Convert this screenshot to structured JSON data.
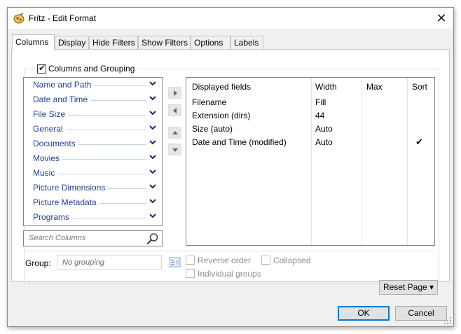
{
  "window": {
    "title": "Fritz - Edit Format",
    "close_glyph": "✕"
  },
  "tabs": [
    {
      "label": "Columns",
      "active": true
    },
    {
      "label": "Display"
    },
    {
      "label": "Hide Filters"
    },
    {
      "label": "Show Filters"
    },
    {
      "label": "Options"
    },
    {
      "label": "Labels"
    }
  ],
  "columns_grouping": {
    "label": "Columns and Grouping",
    "checked": true
  },
  "categories": [
    {
      "label": "Name and Path"
    },
    {
      "label": "Date and Time"
    },
    {
      "label": "File Size"
    },
    {
      "label": "General"
    },
    {
      "label": "Documents"
    },
    {
      "label": "Movies"
    },
    {
      "label": "Music"
    },
    {
      "label": "Picture Dimensions"
    },
    {
      "label": "Picture Metadata"
    },
    {
      "label": "Programs"
    }
  ],
  "search": {
    "placeholder": "Search Columns"
  },
  "fields_table": {
    "headers": [
      "Displayed fields",
      "Width",
      "Max",
      "Sort"
    ],
    "rows": [
      {
        "field": "Filename",
        "width": "Fill",
        "max": "",
        "sort": ""
      },
      {
        "field": "Extension (dirs)",
        "width": "44",
        "max": "",
        "sort": ""
      },
      {
        "field": "Size (auto)",
        "width": "Auto",
        "max": "",
        "sort": ""
      },
      {
        "field": "Date and Time (modified)",
        "width": "Auto",
        "max": "",
        "sort": "✔"
      }
    ]
  },
  "group": {
    "label": "Group:",
    "placeholder": "No grouping",
    "reverse_order": "Reverse order",
    "collapsed": "Collapsed",
    "individual_groups": "Individual groups"
  },
  "buttons": {
    "reset_page": "Reset Page ▾",
    "ok": "OK",
    "cancel": "Cancel"
  },
  "colors": {
    "link_blue": "#1f3f8c",
    "focus_blue": "#0078d7",
    "chevron_navy": "#1a2b6d"
  },
  "icons": {
    "title": "fritz-app-icon",
    "chevron": "chevron-down-icon",
    "search": "magnifier-icon",
    "move": [
      "arrow-right-icon",
      "arrow-left-icon",
      "arrow-up-icon",
      "arrow-down-icon"
    ]
  }
}
